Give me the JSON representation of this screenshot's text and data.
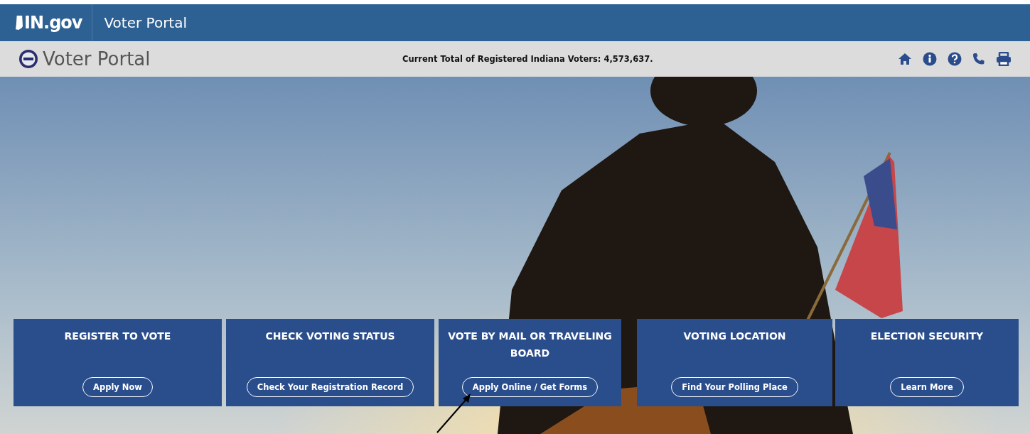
{
  "top_bar": {
    "logo": "IN.gov",
    "title": "Voter Portal"
  },
  "header": {
    "title": "Voter Portal",
    "voter_total": "Current Total of Registered Indiana Voters: 4,573,637."
  },
  "cards": [
    {
      "title": "REGISTER TO VOTE",
      "button": "Apply Now"
    },
    {
      "title": "CHECK VOTING STATUS",
      "button": "Check Your Registration Record"
    },
    {
      "title": "VOTE BY MAIL OR TRAVELING BOARD",
      "button": "Apply Online / Get Forms"
    },
    {
      "title": "VOTING LOCATION",
      "button": "Find Your Polling Place"
    },
    {
      "title": "ELECTION SECURITY",
      "button": "Learn More"
    }
  ]
}
